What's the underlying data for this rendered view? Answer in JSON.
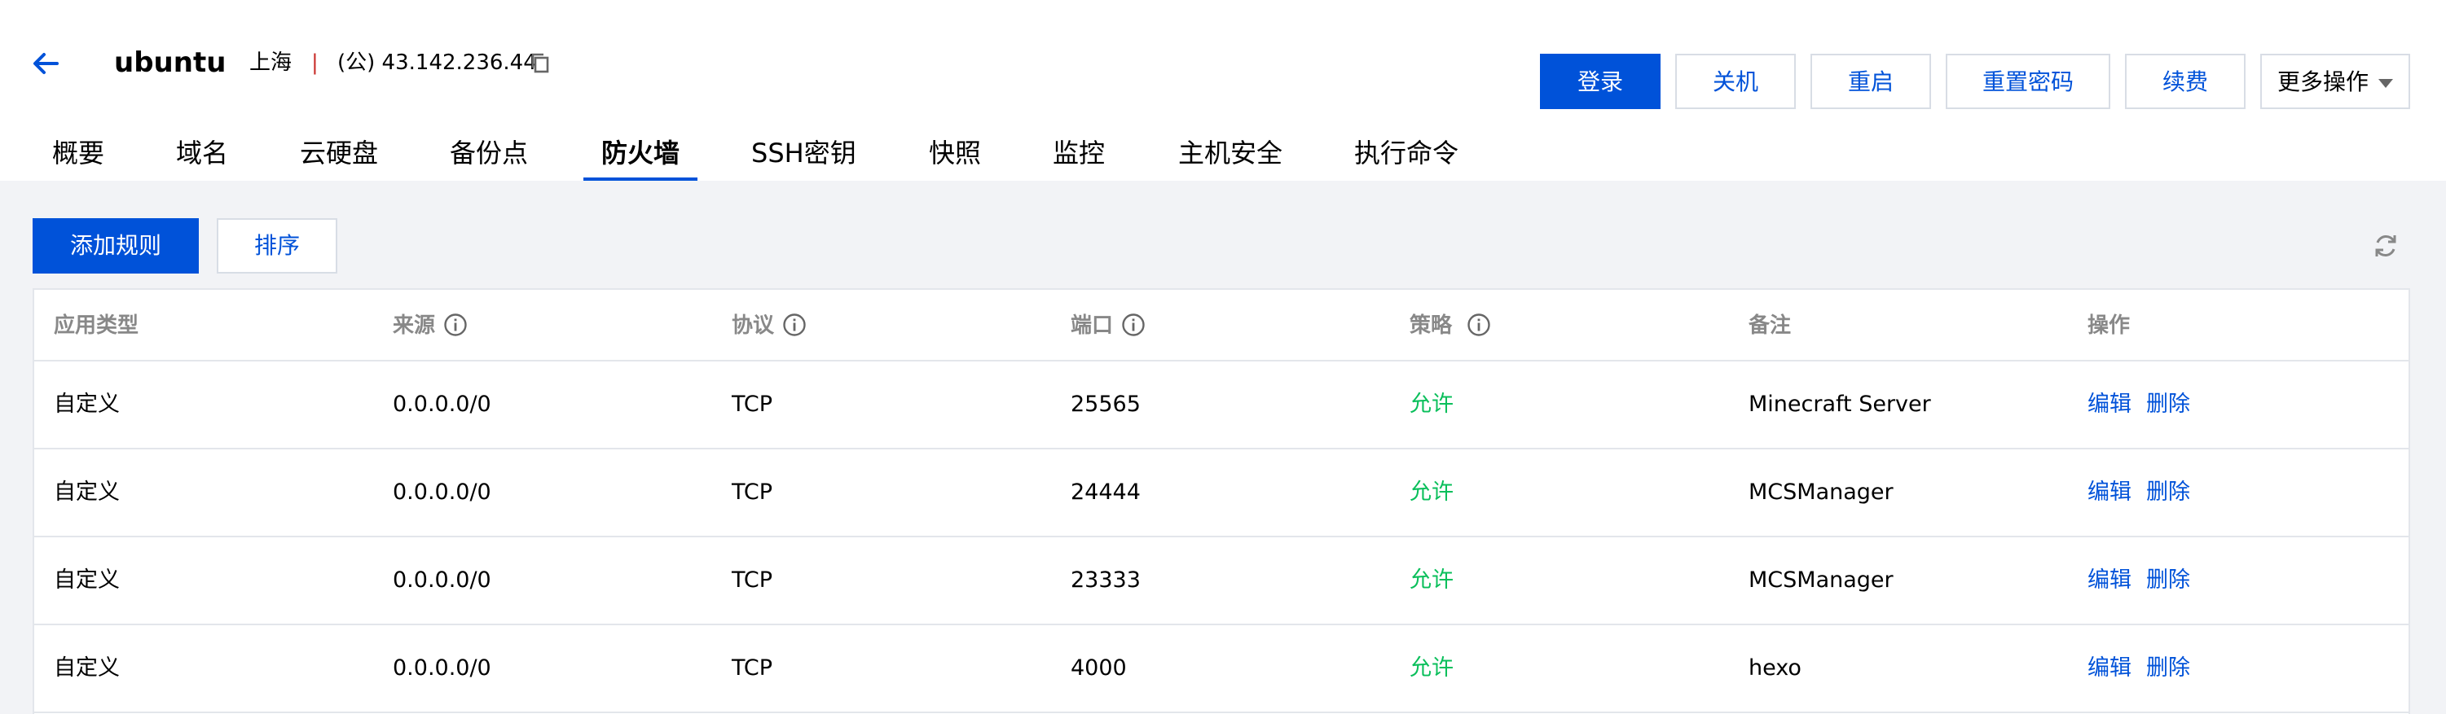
{
  "header": {
    "instance_name": "ubuntu",
    "region": "上海",
    "separator": "|",
    "ip": "(公) 43.142.236.44",
    "icons": {
      "back": "arrow-left-icon",
      "copy": "copy-icon"
    }
  },
  "actions": {
    "login": "登录",
    "shutdown": "关机",
    "restart": "重启",
    "reset_password": "重置密码",
    "renew": "续费",
    "more": "更多操作"
  },
  "tabs": [
    {
      "label": "概要"
    },
    {
      "label": "域名"
    },
    {
      "label": "云硬盘"
    },
    {
      "label": "备份点"
    },
    {
      "label": "防火墙",
      "active": true
    },
    {
      "label": "SSH密钥"
    },
    {
      "label": "快照"
    },
    {
      "label": "监控"
    },
    {
      "label": "主机安全"
    },
    {
      "label": "执行命令"
    }
  ],
  "toolbar": {
    "add_rule": "添加规则",
    "sort": "排序",
    "refresh_icon": "refresh-icon"
  },
  "table": {
    "columns": [
      "应用类型",
      "来源",
      "协议",
      "端口",
      "策略",
      "备注",
      "操作"
    ],
    "rows": [
      {
        "type": "自定义",
        "source": "0.0.0.0/0",
        "protocol": "TCP",
        "port": "25565",
        "policy": "允许",
        "remark": "Minecraft Server",
        "edit": "编辑",
        "delete": "删除"
      },
      {
        "type": "自定义",
        "source": "0.0.0.0/0",
        "protocol": "TCP",
        "port": "24444",
        "policy": "允许",
        "remark": "MCSManager",
        "edit": "编辑",
        "delete": "删除"
      },
      {
        "type": "自定义",
        "source": "0.0.0.0/0",
        "protocol": "TCP",
        "port": "23333",
        "policy": "允许",
        "remark": "MCSManager",
        "edit": "编辑",
        "delete": "删除"
      },
      {
        "type": "自定义",
        "source": "0.0.0.0/0",
        "protocol": "TCP",
        "port": "4000",
        "policy": "允许",
        "remark": "hexo",
        "edit": "编辑",
        "delete": "删除"
      }
    ]
  },
  "colors": {
    "primary": "#0052d9",
    "allow_green": "#0abf5b",
    "header_text": "#888888",
    "page_bg": "#f2f3f6"
  }
}
